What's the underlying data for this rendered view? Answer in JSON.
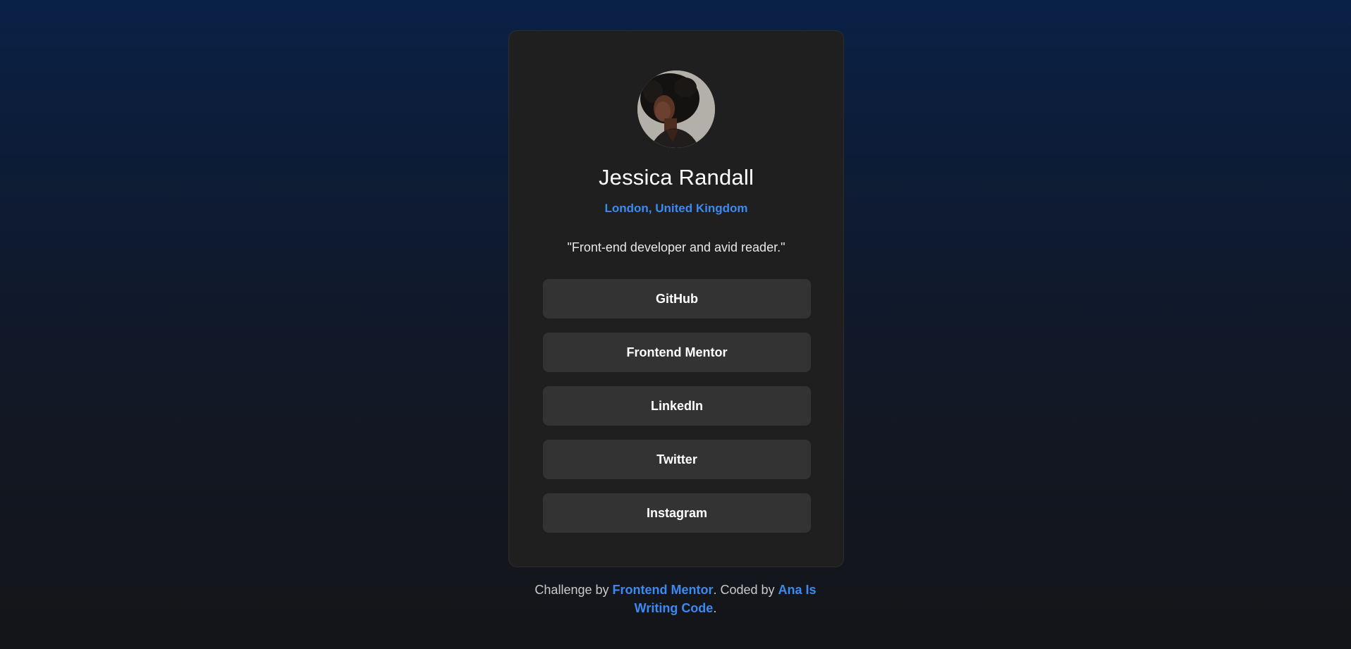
{
  "profile": {
    "name": "Jessica Randall",
    "location": "London, United Kingdom",
    "bio": "\"Front-end developer and avid reader.\""
  },
  "links": [
    {
      "label": "GitHub"
    },
    {
      "label": "Frontend Mentor"
    },
    {
      "label": "LinkedIn"
    },
    {
      "label": "Twitter"
    },
    {
      "label": "Instagram"
    }
  ],
  "footer": {
    "prefix": "Challenge by ",
    "challenge_link": "Frontend Mentor",
    "middle": ". Coded by ",
    "author_link": "Ana Is Writing Code",
    "suffix": "."
  },
  "colors": {
    "accent": "#3b8af2",
    "card": "#1f1f1f",
    "button": "#333333"
  }
}
